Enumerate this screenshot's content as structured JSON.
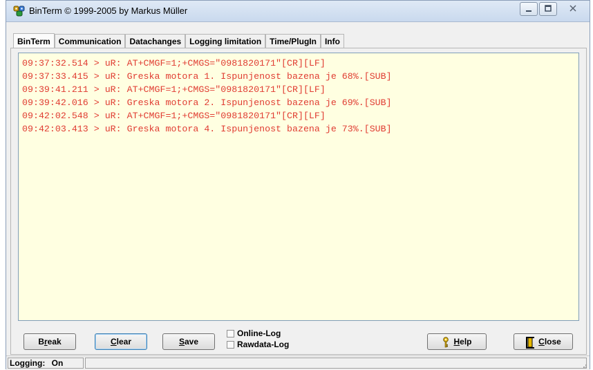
{
  "window": {
    "title": "BinTerm © 1999-2005 by Markus Müller"
  },
  "tabs": [
    {
      "label": "BinTerm",
      "active": true
    },
    {
      "label": "Communication",
      "active": false
    },
    {
      "label": "Datachanges",
      "active": false
    },
    {
      "label": "Logging limitation",
      "active": false
    },
    {
      "label": "Time/PlugIn",
      "active": false
    },
    {
      "label": "Info",
      "active": false
    }
  ],
  "log": {
    "color": "#e03c32",
    "background": "#ffffe1",
    "lines": [
      "09:37:32.514 > uR: AT+CMGF=1;+CMGS=\"0981820171\"[CR][LF]",
      "09:37:33.415 > uR: Greska motora 1. Ispunjenost bazena je 68%.[SUB]",
      "09:39:41.211 > uR: AT+CMGF=1;+CMGS=\"0981820171\"[CR][LF]",
      "09:39:42.016 > uR: Greska motora 2. Ispunjenost bazena je 69%.[SUB]",
      "09:42:02.548 > uR: AT+CMGF=1;+CMGS=\"0981820171\"[CR][LF]",
      "09:42:03.413 > uR: Greska motora 4. Ispunjenost bazena je 73%.[SUB]"
    ]
  },
  "buttons": {
    "break": {
      "pre": "B",
      "accel": "r",
      "post": "eak"
    },
    "clear": {
      "pre": "",
      "accel": "C",
      "post": "lear"
    },
    "save": {
      "pre": "",
      "accel": "S",
      "post": "ave"
    },
    "help": {
      "pre": "",
      "accel": "H",
      "post": "elp",
      "icon": "key-icon"
    },
    "close": {
      "pre": "",
      "accel": "C",
      "post": "lose",
      "icon": "exit-door-icon"
    }
  },
  "checkboxes": {
    "online_log": {
      "label": "Online-Log",
      "checked": false
    },
    "rawdata_log": {
      "label": "Rawdata-Log",
      "checked": false
    }
  },
  "status": {
    "label": "Logging:",
    "value": "On"
  }
}
